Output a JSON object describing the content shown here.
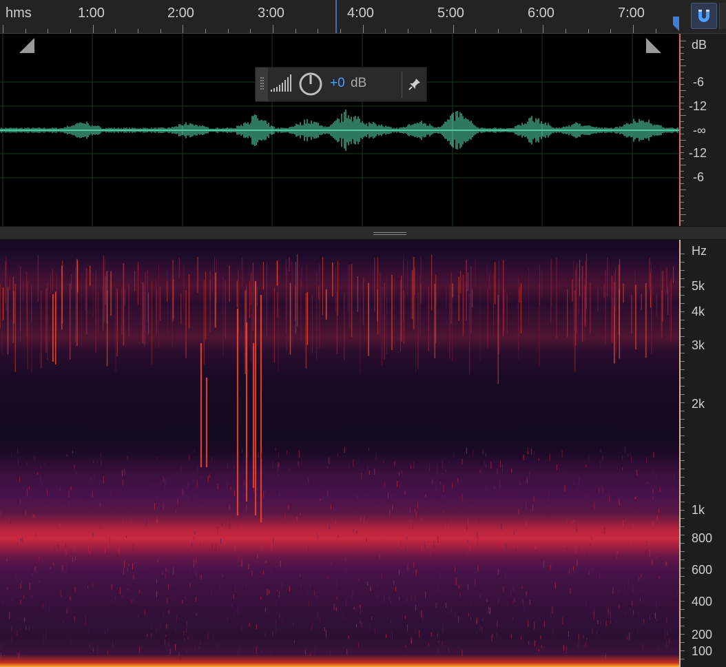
{
  "ruler": {
    "unit": "hms",
    "time_labels": [
      "1:00",
      "2:00",
      "3:00",
      "4:00",
      "5:00",
      "6:00",
      "7:00"
    ]
  },
  "snap_button": {
    "icon": "magnet-icon",
    "state": "active"
  },
  "waveform": {
    "db_unit": "dB",
    "db_labels": [
      "-6",
      "-12",
      "-∞",
      "-12",
      "-6"
    ],
    "wave_color": "#4ec9a0"
  },
  "hud": {
    "gain_value": "+0",
    "gain_unit": "dB",
    "icons": [
      "volume-bars-icon",
      "gain-knob-icon",
      "pin-icon"
    ]
  },
  "spectrogram": {
    "hz_unit": "Hz",
    "hz_labels": [
      "5k",
      "4k",
      "3k",
      "2k",
      "1k",
      "800",
      "600",
      "400",
      "200",
      "100"
    ]
  },
  "colors": {
    "accent": "#4a9eff",
    "playhead": "#3d6db5",
    "waveform": "#4ec9a0"
  }
}
